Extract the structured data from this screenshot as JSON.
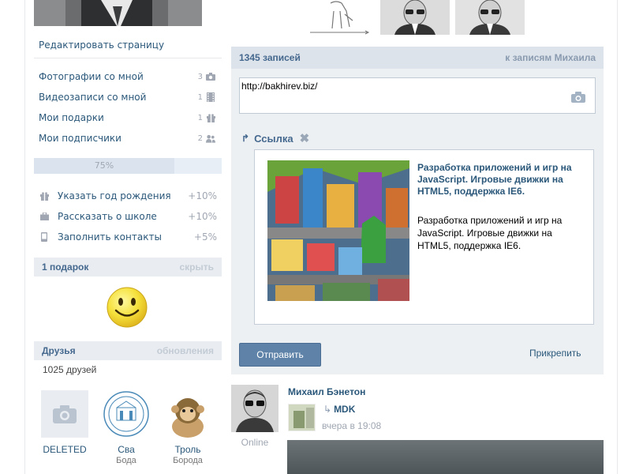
{
  "left": {
    "edit_page": "Редактировать страницу",
    "menu": [
      {
        "label": "Фотографии со мной",
        "count": "3",
        "icon": "camera-icon"
      },
      {
        "label": "Видеозаписи со мной",
        "count": "1",
        "icon": "film-icon"
      },
      {
        "label": "Мои подарки",
        "count": "1",
        "icon": "gift-icon"
      },
      {
        "label": "Мои подписчики",
        "count": "2",
        "icon": "people-icon"
      }
    ],
    "profile_progress": {
      "label": "75%",
      "value": 0.75
    },
    "tasks": [
      {
        "label": "Указать год рождения",
        "percent": "+10%",
        "icon": "gift-icon"
      },
      {
        "label": "Рассказать о школе",
        "percent": "+10%",
        "icon": "briefcase-icon"
      },
      {
        "label": "Заполнить контакты",
        "percent": "+5%",
        "icon": "phone-icon"
      }
    ],
    "gifts": {
      "title": "1 подарок",
      "action": "скрыть"
    },
    "friends": {
      "title": "Друзья",
      "action": "обновления",
      "count": "1025 друзей",
      "items": [
        {
          "name": "DELETED",
          "sub": ""
        },
        {
          "name": "Сва",
          "sub": "Бода"
        },
        {
          "name": "Троль",
          "sub": "Борода"
        }
      ]
    }
  },
  "wall": {
    "count": "1345 записей",
    "to_posts": "к записям Михаила",
    "input_value": "http://bakhirev.biz/",
    "attachment": {
      "type": "Ссылка",
      "title": "Разработка приложений и игр на JavaScript. Игровые движки на HTML5, поддержка IE6.",
      "description": "Разработка приложений и игр на JavaScript. Игровые движки на HTML5, поддержка IE6."
    },
    "send": "Отправить",
    "attach": "Прикрепить"
  },
  "post": {
    "author": "Михаил Бэнетон",
    "online": "Online",
    "source": "MDK",
    "time": "вчера в 19:08"
  },
  "colors": {
    "link": "#2b587a",
    "header_bg": "#dde3eb",
    "button": "#5e82a8"
  }
}
